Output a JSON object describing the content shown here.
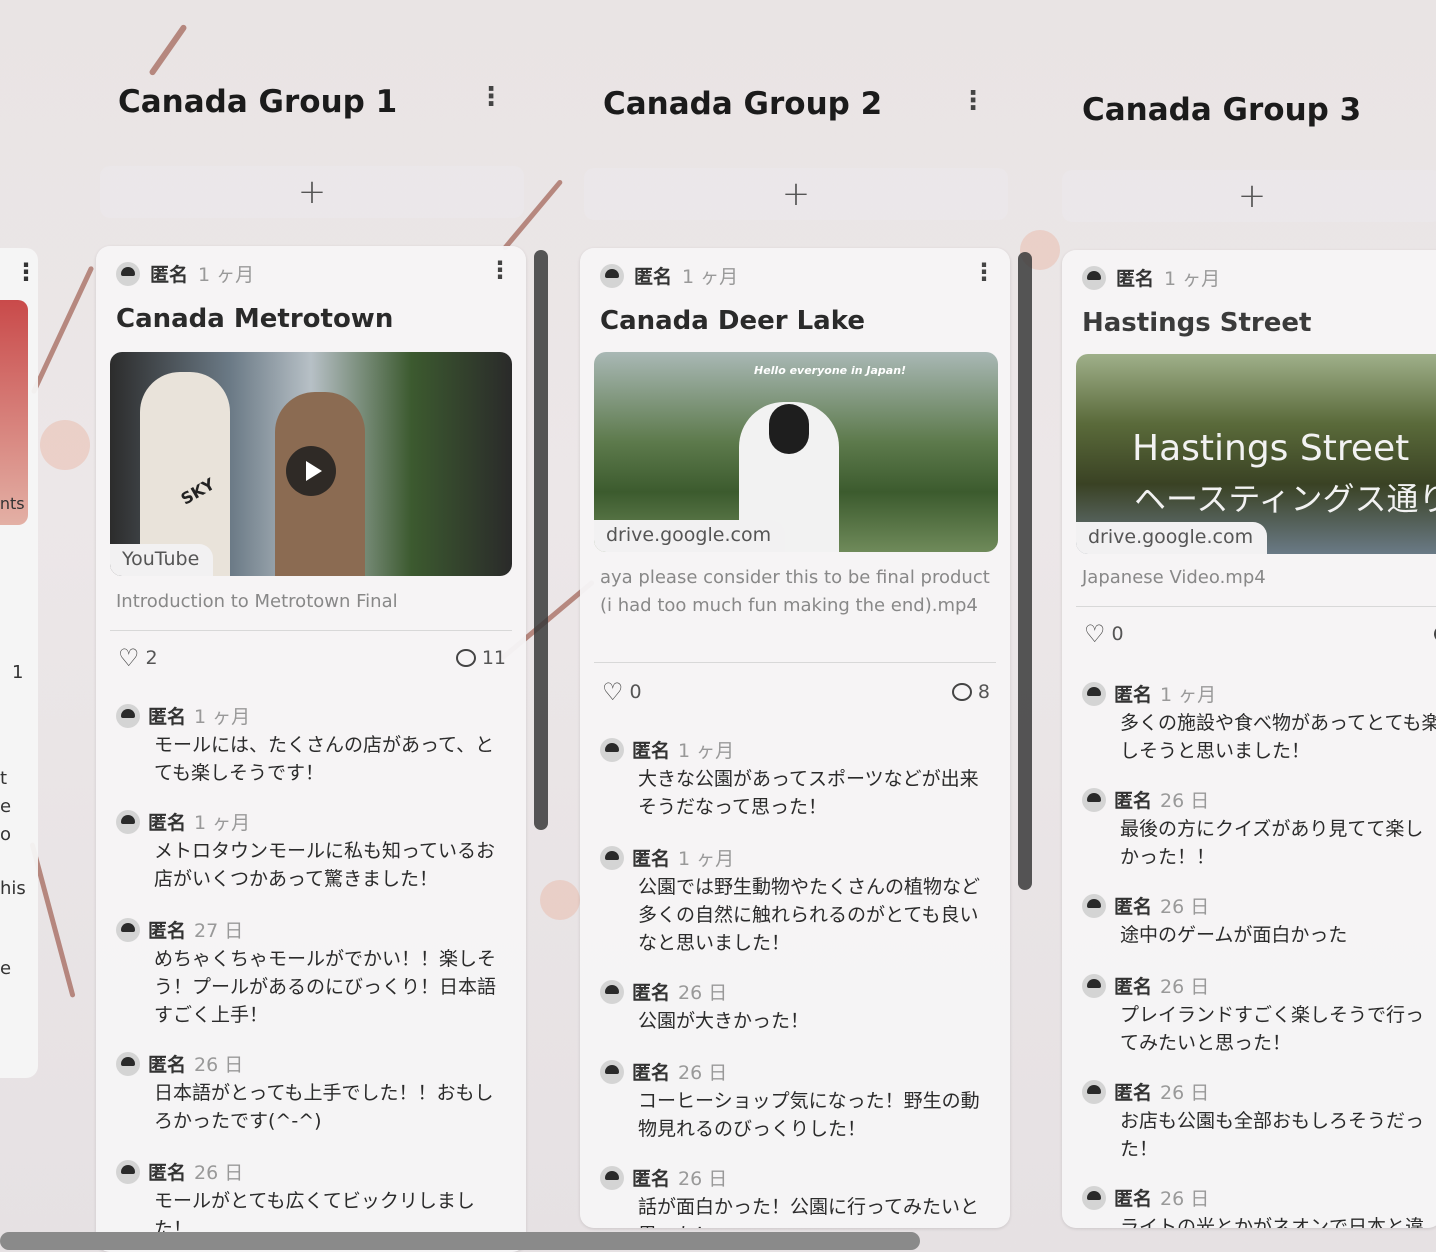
{
  "ghost_column": {
    "menu": "⋮",
    "partial_label": "ents",
    "likes": "1",
    "side_letters": [
      "t",
      "e",
      "o",
      "his",
      "e"
    ]
  },
  "columns": [
    {
      "title": "Canada Group 1",
      "menu": "⋮",
      "add": "+",
      "card": {
        "author": "匿名",
        "time": "1 ヶ月",
        "menu": "⋮",
        "title": "Canada Metrotown",
        "media_source": "YouTube",
        "media_text": "SKY",
        "caption": "Introduction to Metrotown Final",
        "likes": "2",
        "comments": "11",
        "comment_list": [
          {
            "author": "匿名",
            "time": "1 ヶ月",
            "text": "モールには、たくさんの店があって、とても楽しそうです！"
          },
          {
            "author": "匿名",
            "time": "1 ヶ月",
            "text": "メトロタウンモールに私も知っているお店がいくつかあって驚きました！"
          },
          {
            "author": "匿名",
            "time": "27 日",
            "text": "めちゃくちゃモールがでかい！！楽しそう！プールがあるのにびっくり！日本語すごく上手！"
          },
          {
            "author": "匿名",
            "time": "26 日",
            "text": "日本語がとっても上手でした！！おもしろかったです(^-^)"
          },
          {
            "author": "匿名",
            "time": "26 日",
            "text": "モールがとても広くてビックリしました！"
          }
        ]
      }
    },
    {
      "title": "Canada Group 2",
      "menu": "⋮",
      "add": "+",
      "card": {
        "author": "匿名",
        "time": "1 ヶ月",
        "menu": "⋮",
        "title": "Canada Deer Lake",
        "media_source": "drive.google.com",
        "media_text": "Hello everyone in Japan!",
        "caption": "aya please consider this to be final product (i had too much fun making the end).mp4",
        "likes": "0",
        "comments": "8",
        "comment_list": [
          {
            "author": "匿名",
            "time": "1 ヶ月",
            "text": "大きな公園があってスポーツなどが出来そうだなって思った！"
          },
          {
            "author": "匿名",
            "time": "1 ヶ月",
            "text": "公園では野生動物やたくさんの植物など多くの自然に触れられるのがとても良いなと思いました！"
          },
          {
            "author": "匿名",
            "time": "26 日",
            "text": "公園が大きかった！"
          },
          {
            "author": "匿名",
            "time": "26 日",
            "text": "コーヒーショップ気になった！野生の動物見れるのびっくりした！"
          },
          {
            "author": "匿名",
            "time": "26 日",
            "text": "話が面白かった！公園に行ってみたいと思った！"
          }
        ]
      }
    },
    {
      "title": "Canada Group 3",
      "menu": "⋮",
      "add": "+",
      "card": {
        "author": "匿名",
        "time": "1 ヶ月",
        "menu": "",
        "title": "Hastings Street",
        "media_source": "drive.google.com",
        "media_text_en": "Hastings Street",
        "media_text_jp": "ヘースティングス通り",
        "caption": "Japanese Video.mp4",
        "likes": "0",
        "comments": "",
        "comment_list": [
          {
            "author": "匿名",
            "time": "1 ヶ月",
            "text": "多くの施設や食べ物があってとても楽しそうと思いました！"
          },
          {
            "author": "匿名",
            "time": "26 日",
            "text": "最後の方にクイズがあり見てて楽しかった！！"
          },
          {
            "author": "匿名",
            "time": "26 日",
            "text": "途中のゲームが面白かった"
          },
          {
            "author": "匿名",
            "time": "26 日",
            "text": "プレイランドすごく楽しそうで行ってみたいと思った！"
          },
          {
            "author": "匿名",
            "time": "26 日",
            "text": "お店も公園も全部おもしろそうだった！"
          },
          {
            "author": "匿名",
            "time": "26 日",
            "text": "ライトの光とかがネオンで日本と違う"
          }
        ]
      }
    }
  ]
}
